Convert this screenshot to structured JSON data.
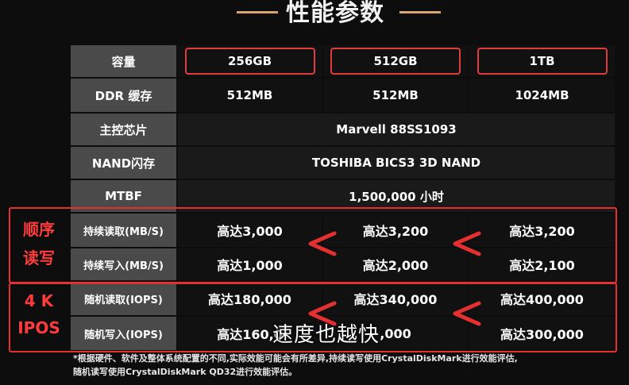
{
  "header": {
    "title": "性能参数"
  },
  "capacity": {
    "label": "容量",
    "values": [
      "256GB",
      "512GB",
      "1TB"
    ]
  },
  "cache": {
    "label": "DDR 缓存",
    "values": [
      "512MB",
      "512MB",
      "1024MB"
    ]
  },
  "controller": {
    "label": "主控芯片",
    "value": "Marvell 88SS1093"
  },
  "nand": {
    "label": "NAND闪存",
    "value": "TOSHIBA BICS3 3D NAND"
  },
  "mtbf": {
    "label": "MTBF",
    "value": "1,500,000 小时"
  },
  "seq_read": {
    "label": "持续读取(MB/S)",
    "values": [
      "高达3,000",
      "高达3,200",
      "高达3,200"
    ]
  },
  "seq_write": {
    "label": "持续写入(MB/S)",
    "values": [
      "高达1,000",
      "高达2,000",
      "高达2,100"
    ]
  },
  "rand_read": {
    "label": "随机读取(IOPS)",
    "values": [
      "高达180,000",
      "高达340,000",
      "高达400,000"
    ]
  },
  "rand_write": {
    "label": "随机写入(IOPS)",
    "values": [
      "高达160,0",
      ",000",
      "高达300,000"
    ]
  },
  "groups": {
    "sequential": [
      "顺序",
      "读写"
    ],
    "random": [
      "4 K",
      "IPOS"
    ]
  },
  "subtitle": "速度也越快",
  "footnote": {
    "line1": "*根据硬件、软件及整体系统配置的不同,实际效能可能会有所差异,持续读写使用CrystalDiskMark进行效能评估,",
    "line2": "随机读写使用CrystalDiskMark QD32进行效能评估。"
  },
  "colors": {
    "accent_red": "#e53030",
    "title_line": "#d9a66b",
    "label_bg": "#4a4a4a"
  }
}
